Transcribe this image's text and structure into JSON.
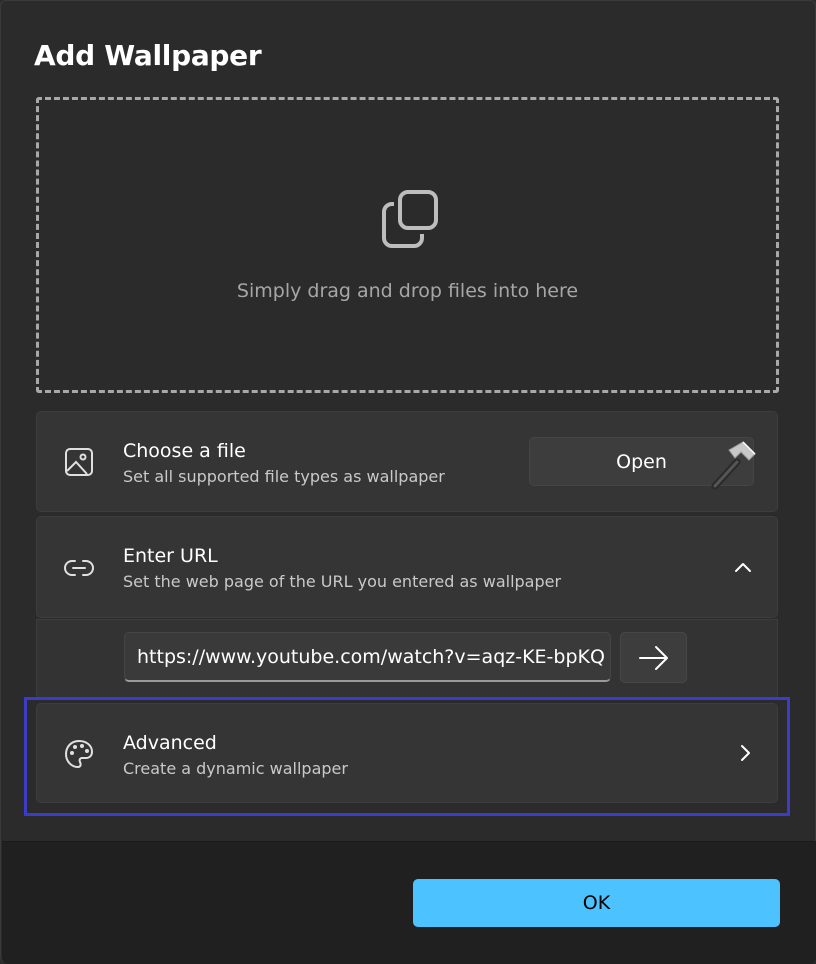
{
  "dialog": {
    "title": "Add Wallpaper"
  },
  "dropzone": {
    "text": "Simply drag and drop files into here",
    "icon": "copy-icon"
  },
  "choose_file": {
    "title": "Choose a file",
    "subtitle": "Set all supported file types as wallpaper",
    "button_label": "Open",
    "icon": "image-icon"
  },
  "enter_url": {
    "title": "Enter URL",
    "subtitle": "Set the web page of the URL you entered as wallpaper",
    "icon": "link-icon",
    "expanded": true,
    "value": "https://www.youtube.com/watch?v=aqz-KE-bpKQ"
  },
  "advanced": {
    "title": "Advanced",
    "subtitle": "Create a dynamic wallpaper",
    "icon": "palette-icon"
  },
  "footer": {
    "ok_label": "OK"
  },
  "colors": {
    "accent": "#4cc2ff",
    "highlight": "#3c3cc8",
    "background": "#2b2b2b"
  }
}
